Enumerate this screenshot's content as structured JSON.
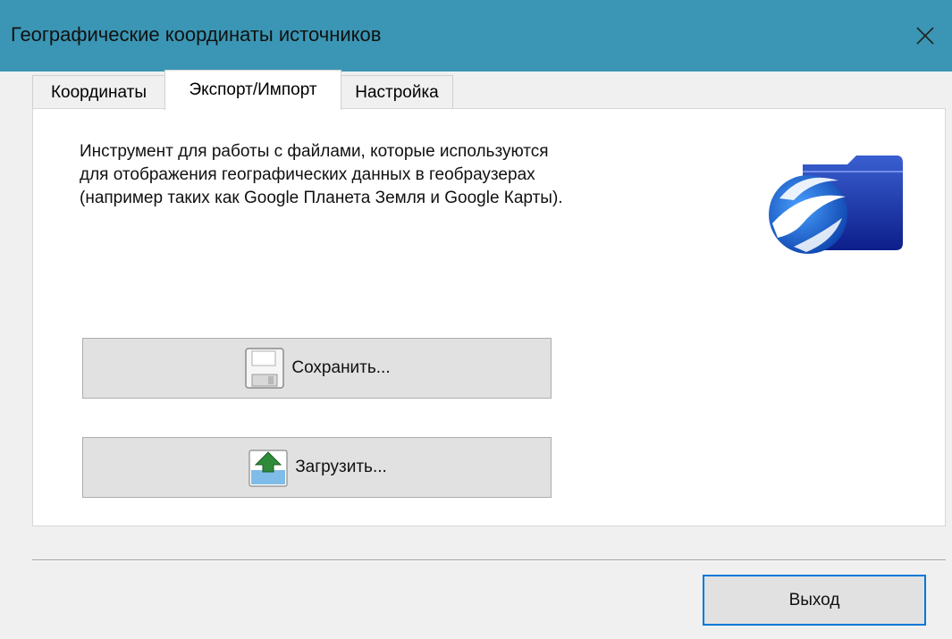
{
  "window": {
    "title": "Географические координаты источников",
    "close_icon": "close-icon",
    "titlebar_color": "#3a96b4"
  },
  "tabs": [
    {
      "label": "Координаты",
      "active": false
    },
    {
      "label": "Экспорт/Импорт",
      "active": true
    },
    {
      "label": "Настройка",
      "active": false
    }
  ],
  "export_tab": {
    "description_lines": [
      "Инструмент для работы с файлами, которые используются",
      "для отображения географических данных в геобраузерах",
      "(например таких как Google Планета Земля и Google Карты)."
    ],
    "illustration_icon": "google-earth-folder-icon",
    "save_button": {
      "label": "Сохранить...",
      "icon": "floppy-disk-icon"
    },
    "load_button": {
      "label": "Загрузить...",
      "icon": "upload-tray-icon"
    }
  },
  "footer": {
    "exit_label": "Выход",
    "focus_color": "#0078d7"
  }
}
